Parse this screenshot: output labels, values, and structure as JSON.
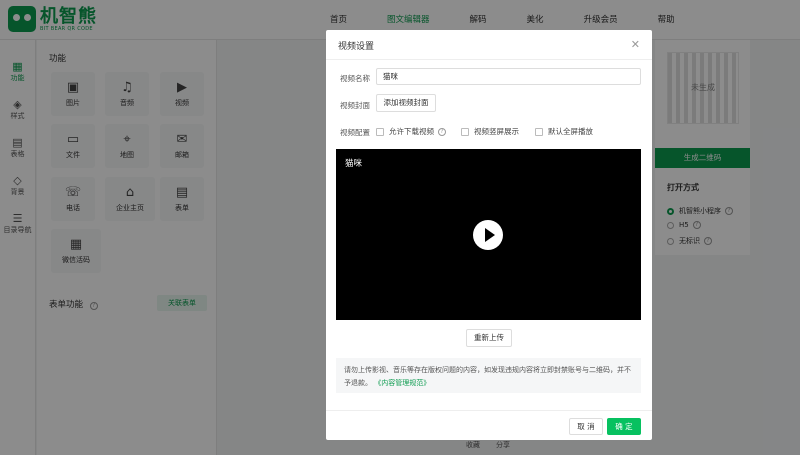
{
  "brand": {
    "name": "机智熊",
    "sub": "BIT BEAR QR CODE",
    "color": "#0c9b4f"
  },
  "nav": [
    {
      "label": "首页"
    },
    {
      "label": "图文编辑器"
    },
    {
      "label": "解码"
    },
    {
      "label": "美化"
    },
    {
      "label": "升级会员"
    },
    {
      "label": "帮助"
    }
  ],
  "sidebar": [
    {
      "label": "功能",
      "icon": "grid-icon"
    },
    {
      "label": "样式",
      "icon": "layers-icon"
    },
    {
      "label": "表格",
      "icon": "table-icon"
    },
    {
      "label": "背景",
      "icon": "paint-icon"
    },
    {
      "label": "目录导航",
      "icon": "toc-icon"
    }
  ],
  "panel": {
    "title": "功能",
    "tiles": [
      {
        "label": "图片",
        "icon": "image-icon"
      },
      {
        "label": "音频",
        "icon": "music-icon"
      },
      {
        "label": "视频",
        "icon": "video-icon"
      },
      {
        "label": "文件",
        "icon": "folder-icon"
      },
      {
        "label": "地图",
        "icon": "map-pin-icon"
      },
      {
        "label": "邮箱",
        "icon": "mail-icon"
      },
      {
        "label": "电话",
        "icon": "phone-icon"
      },
      {
        "label": "企业主页",
        "icon": "home-icon"
      },
      {
        "label": "表单",
        "icon": "form-icon"
      },
      {
        "label": "微信活码",
        "icon": "qrcode-icon"
      }
    ],
    "form_title": "表单功能",
    "assoc_label": "关联表单"
  },
  "right": {
    "qr_placeholder": "未生成",
    "generate_label": "生成二维码",
    "open_title": "打开方式",
    "options": [
      {
        "label": "机智熊小程序"
      },
      {
        "label": "H5"
      },
      {
        "label": "无标识"
      }
    ]
  },
  "footer": {
    "collect": "收藏",
    "share": "分享"
  },
  "modal": {
    "title": "视频设置",
    "name_label": "视频名称",
    "name_value": "猫咪",
    "cover_label": "视频封面",
    "cover_button": "添加视频封面",
    "config_label": "视频配置",
    "config_options": [
      {
        "label": "允许下载视频"
      },
      {
        "label": "视频竖屏展示"
      },
      {
        "label": "默认全屏播放"
      }
    ],
    "video_title": "猫咪",
    "reupload_label": "重新上传",
    "notice_text": "请勿上传影视、音乐等存在版权问题的内容，如发现违规内容将立即封禁账号与二维码，并不予退款。",
    "notice_link": "《内容管理规范》",
    "cancel_label": "取 消",
    "ok_label": "确 定",
    "ok_color": "#07c160"
  }
}
